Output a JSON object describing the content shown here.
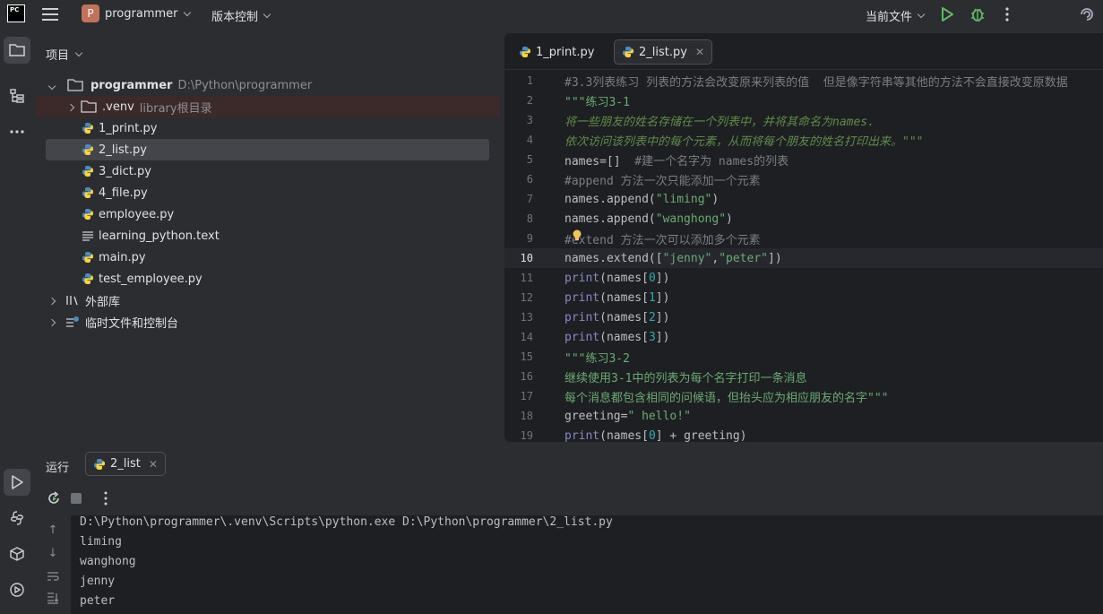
{
  "titlebar": {
    "logo_text": "PC",
    "project_badge": "P",
    "project_name": "programmer",
    "vcs_label": "版本控制",
    "run_config": "当前文件"
  },
  "project_panel": {
    "title": "项目",
    "root": {
      "name": "programmer",
      "path": "D:\\Python\\programmer"
    },
    "venv": {
      "name": ".venv",
      "note": "library根目录"
    },
    "files": [
      {
        "name": "1_print.py",
        "type": "python"
      },
      {
        "name": "2_list.py",
        "type": "python"
      },
      {
        "name": "3_dict.py",
        "type": "python"
      },
      {
        "name": "4_file.py",
        "type": "python"
      },
      {
        "name": "employee.py",
        "type": "python"
      },
      {
        "name": "learning_python.text",
        "type": "text"
      },
      {
        "name": "main.py",
        "type": "python"
      },
      {
        "name": "test_employee.py",
        "type": "python"
      }
    ],
    "external_libs": "外部库",
    "scratches": "临时文件和控制台"
  },
  "editor": {
    "tabs": [
      {
        "label": "1_print.py"
      },
      {
        "label": "2_list.py"
      }
    ],
    "current_line": 10,
    "lines": [
      {
        "n": "1",
        "text": "#3.3列表练习 列表的方法会改变原来列表的值  但是像字符串等其他的方法不会直接改变原数据"
      },
      {
        "n": "2",
        "text": "\"\"\"练习3-1"
      },
      {
        "n": "3",
        "text": "将一些朋友的姓名存储在一个列表中，并将其命名为names."
      },
      {
        "n": "4",
        "text": "依次访问该列表中的每个元素，从而将每个朋友的姓名打印出来。\"\"\""
      },
      {
        "n": "5",
        "text": "names=[]  #建一个名字为 names的列表"
      },
      {
        "n": "6",
        "text": "#append 方法一次只能添加一个元素"
      },
      {
        "n": "7",
        "text": "names.append(\"liming\")"
      },
      {
        "n": "8",
        "text": "names.append(\"wanghong\")"
      },
      {
        "n": "9",
        "text": "#extend 方法一次可以添加多个元素"
      },
      {
        "n": "10",
        "text": "names.extend([\"jenny\",\"peter\"])"
      },
      {
        "n": "11",
        "text": "print(names[0])"
      },
      {
        "n": "12",
        "text": "print(names[1])"
      },
      {
        "n": "13",
        "text": "print(names[2])"
      },
      {
        "n": "14",
        "text": "print(names[3])"
      },
      {
        "n": "15",
        "text": "\"\"\"练习3-2"
      },
      {
        "n": "16",
        "text": "继续使用3-1中的列表为每个名字打印一条消息"
      },
      {
        "n": "17",
        "text": "每个消息都包含相同的问候语，但抬头应为相应朋友的名字\"\"\""
      },
      {
        "n": "18",
        "text": "greeting=\" hello!\""
      },
      {
        "n": "19",
        "text": "print(names[0] + greeting)"
      }
    ]
  },
  "run_panel": {
    "title": "运行",
    "tab_label": "2_list",
    "output": [
      "D:\\Python\\programmer\\.venv\\Scripts\\python.exe D:\\Python\\programmer\\2_list.py",
      "liming",
      "wanghong",
      "jenny",
      "peter"
    ]
  },
  "colors": {
    "background": "#2b2d30",
    "editor_bg": "#1e1f22",
    "run_green": "#5fb865",
    "python_blue": "#4b8bbe",
    "python_yellow": "#ffd43b"
  }
}
